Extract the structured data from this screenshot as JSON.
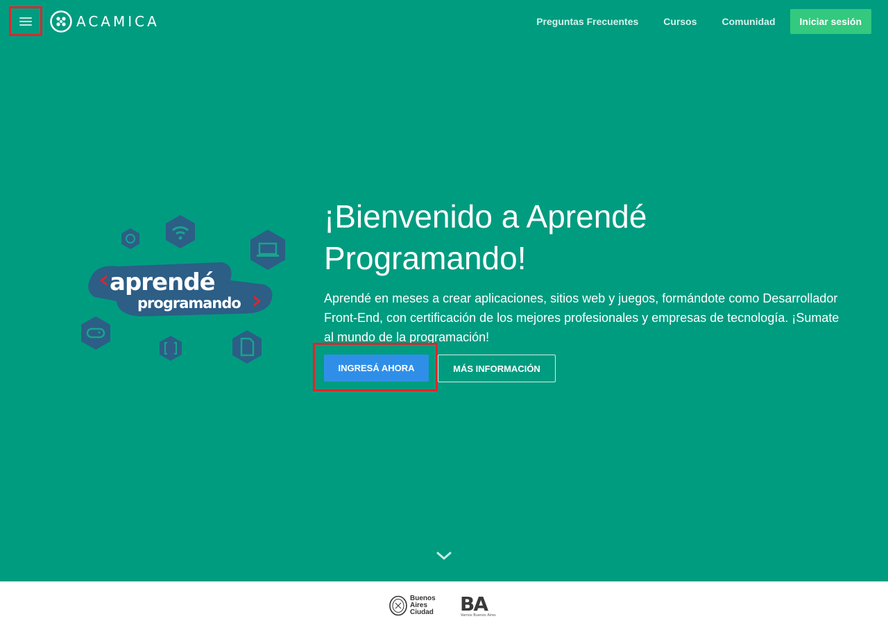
{
  "header": {
    "brand": "ACAMICA",
    "nav": [
      {
        "label": "Preguntas Frecuentes"
      },
      {
        "label": "Cursos"
      },
      {
        "label": "Comunidad"
      }
    ],
    "login_label": "Iniciar sesión"
  },
  "hero": {
    "art_logo_line1": "aprendé",
    "art_logo_line2": "programando",
    "title": "¡Bienvenido a Aprendé Programando!",
    "text": "Aprendé en meses a crear aplicaciones, sitios web y juegos, formándote como Desarrollador Front-End, con certificación de los mejores profesionales y empresas de tecnología. ¡Sumate al mundo de la programación!",
    "primary_cta": "INGRESÁ AHORA",
    "secondary_cta": "MÁS INFORMACIÓN"
  },
  "footer": {
    "city_logo_lines": [
      "Buenos",
      "Aires",
      "Ciudad"
    ],
    "ba_logo_text": "BA",
    "ba_logo_tagline": "Vamos Buenos Aires"
  },
  "colors": {
    "background": "#009c80",
    "login_button": "#33c97e",
    "primary_button": "#2f8fe8",
    "highlight_box": "#e0262b",
    "icon_hex": "#2c5e86"
  },
  "icons": [
    "menu-icon",
    "acamica-logo-icon",
    "wifi-icon",
    "laptop-icon",
    "sync-icon",
    "gamepad-icon",
    "brackets-icon",
    "html-file-icon",
    "chevron-down-icon"
  ]
}
